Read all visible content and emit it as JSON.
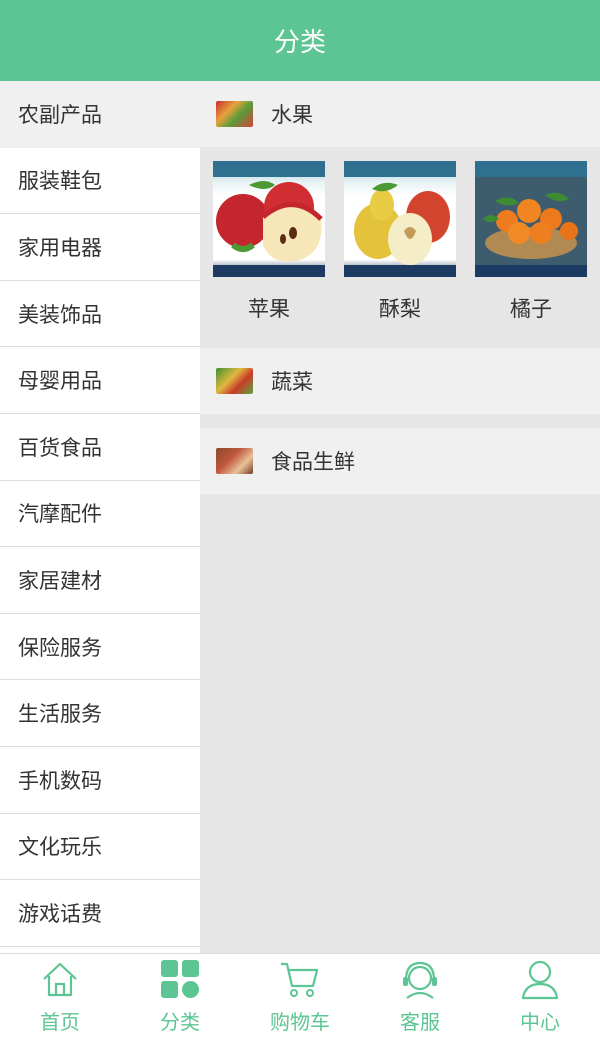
{
  "header": {
    "title": "分类"
  },
  "sidebar": {
    "items": [
      {
        "label": "农副产品"
      },
      {
        "label": "服装鞋包"
      },
      {
        "label": "家用电器"
      },
      {
        "label": "美装饰品"
      },
      {
        "label": "母婴用品"
      },
      {
        "label": "百货食品"
      },
      {
        "label": "汽摩配件"
      },
      {
        "label": "家居建材"
      },
      {
        "label": "保险服务"
      },
      {
        "label": "生活服务"
      },
      {
        "label": "手机数码"
      },
      {
        "label": "文化玩乐"
      },
      {
        "label": "游戏话费"
      }
    ],
    "active_index": 0
  },
  "content": {
    "categories": [
      {
        "label": "水果",
        "thumb": "fruit-thumbnail"
      },
      {
        "label": "蔬菜",
        "thumb": "vegetable-thumbnail"
      },
      {
        "label": "食品生鲜",
        "thumb": "fresh-food-thumbnail"
      }
    ],
    "products": [
      {
        "label": "苹果",
        "image": "apple-image"
      },
      {
        "label": "酥梨",
        "image": "pear-image"
      },
      {
        "label": "橘子",
        "image": "orange-image"
      }
    ]
  },
  "tabbar": {
    "items": [
      {
        "label": "首页",
        "icon": "home-icon"
      },
      {
        "label": "分类",
        "icon": "category-icon"
      },
      {
        "label": "购物车",
        "icon": "cart-icon"
      },
      {
        "label": "客服",
        "icon": "customer-service-icon"
      },
      {
        "label": "中心",
        "icon": "user-icon"
      }
    ],
    "active_index": 1
  },
  "colors": {
    "accent": "#5cc593",
    "sidebar_active_bg": "#f0f0f0",
    "content_bg": "#e6e6e6"
  }
}
